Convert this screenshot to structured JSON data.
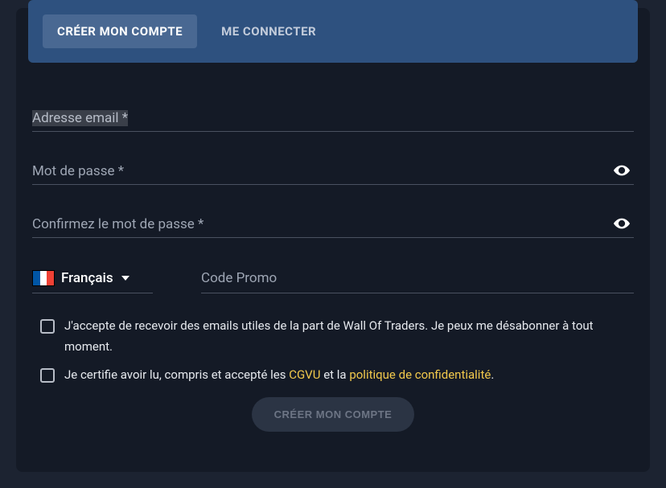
{
  "tabs": {
    "create": "CRÉER MON COMPTE",
    "login": "ME CONNECTER"
  },
  "fields": {
    "email_label": "Adresse email *",
    "password_label": "Mot de passe *",
    "confirm_label": "Confirmez le mot de passe *",
    "promo_placeholder": "Code Promo"
  },
  "language": {
    "selected": "Français"
  },
  "checkboxes": {
    "newsletter": "J'accepte de recevoir des emails utiles de la part de Wall Of Traders. Je peux me désabonner à tout moment.",
    "terms_prefix": "Je certifie avoir lu, compris et accepté les ",
    "terms_cgvу": "CGVU",
    "terms_mid": " et la ",
    "terms_privacy": "politique de confidentialité",
    "terms_suffix": "."
  },
  "submit_label": "CRÉER MON COMPTE"
}
